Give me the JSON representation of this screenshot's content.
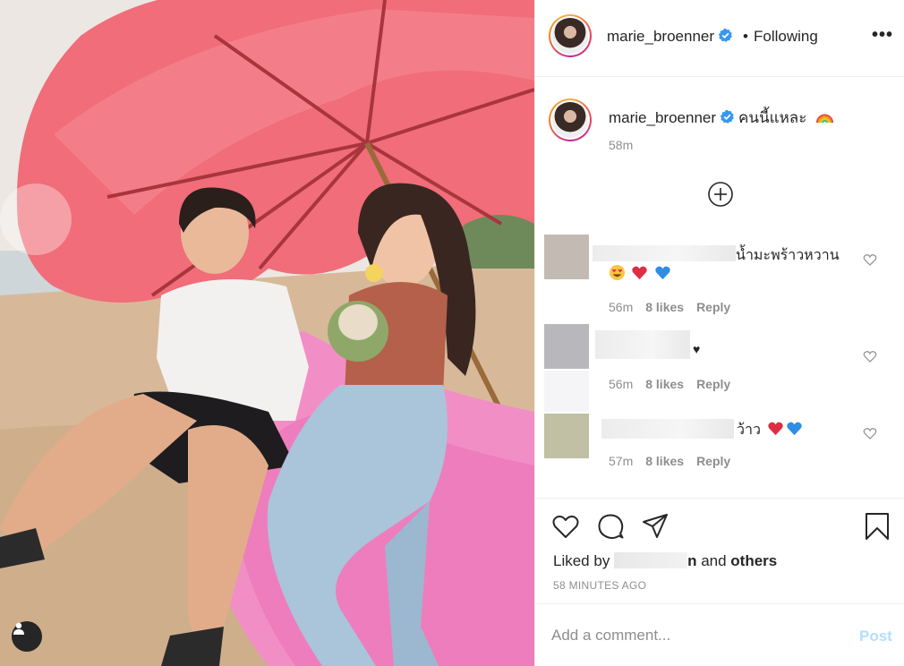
{
  "post": {
    "username": "marie_broenner",
    "follow_label": "Following",
    "more_label": "•••",
    "caption_text": "คนนี้แหละ",
    "caption_emoji": "rainbow-emoji",
    "caption_time": "58m",
    "liked_prefix": "Liked by",
    "liked_name_suffix": "n",
    "liked_and": "and",
    "liked_others": "others",
    "time_ago": "58 MINUTES AGO",
    "add_comment_placeholder": "Add a comment...",
    "post_label": "Post"
  },
  "comments": [
    {
      "text_visible": "น้ำมะพร้าวหวาน",
      "emojis": [
        "heart-eyes-emoji",
        "red-heart-emoji",
        "blue-heart-emoji"
      ],
      "time": "56m",
      "likes": "8 likes",
      "reply": "Reply",
      "avatar_color": "#c4bab4"
    },
    {
      "text_visible": "♥",
      "time": "56m",
      "likes": "8 likes",
      "reply": "Reply",
      "avatar_color": "#b8b8bc"
    },
    {
      "text_visible": "ว้าว",
      "emojis": [
        "red-heart-emoji",
        "blue-heart-emoji"
      ],
      "time": "57m",
      "likes": "8 likes",
      "reply": "Reply",
      "avatar_color": "#c1bfa4"
    }
  ],
  "colors": {
    "verified": "#3897f0",
    "post_disabled": "#b2dffc",
    "muted_text": "#8e8e8e",
    "umbrella": "#f06d79"
  },
  "icons": {
    "photo_user_tag": "user-tag-icon",
    "load_more": "plus-circle-icon",
    "like": "heart-outline-icon",
    "comment": "comment-bubble-icon",
    "share": "paper-plane-icon",
    "save": "bookmark-icon"
  }
}
